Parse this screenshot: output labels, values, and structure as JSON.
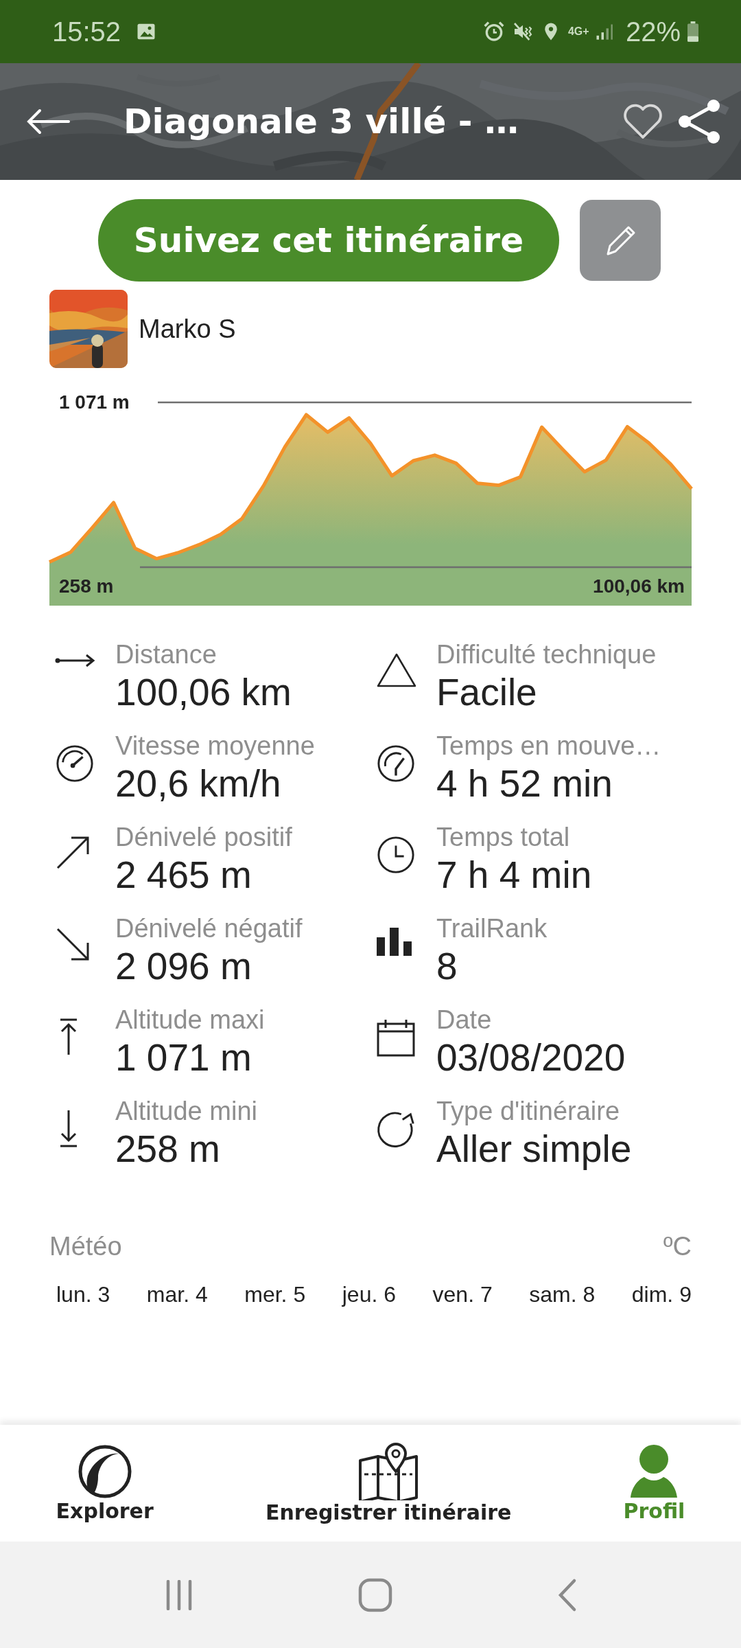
{
  "status_bar": {
    "time": "15:52",
    "network": "4G+",
    "battery": "22%"
  },
  "header": {
    "title": "Diagonale 3 villé - …",
    "favorite": false
  },
  "follow_button": "Suivez cet itinéraire",
  "author": {
    "name": "Marko S"
  },
  "elevation_profile": {
    "max_altitude": "1 071 m",
    "min_altitude": "258 m",
    "distance": "100,06 km"
  },
  "stats": [
    {
      "label": "Distance",
      "value": "100,06 km"
    },
    {
      "label": "Difficulté technique",
      "value": "Facile"
    },
    {
      "label": "Vitesse moyenne",
      "value": "20,6 km/h"
    },
    {
      "label": "Temps en mouve…",
      "value": "4 h 52 min"
    },
    {
      "label": "Dénivelé positif",
      "value": "2 465 m"
    },
    {
      "label": "Temps total",
      "value": "7 h 4 min"
    },
    {
      "label": "Dénivelé négatif",
      "value": "2 096 m"
    },
    {
      "label": "TrailRank",
      "value": "8"
    },
    {
      "label": "Altitude maxi",
      "value": "1 071 m"
    },
    {
      "label": "Date",
      "value": "03/08/2020"
    },
    {
      "label": "Altitude mini",
      "value": "258 m"
    },
    {
      "label": "Type d'itinéraire",
      "value": "Aller simple"
    }
  ],
  "weather": {
    "title": "Météo",
    "unit": "ºC",
    "days": [
      "lun. 3",
      "mar. 4",
      "mer. 5",
      "jeu. 6",
      "ven. 7",
      "sam. 8",
      "dim. 9"
    ]
  },
  "bottom_nav": [
    {
      "label": "Explorer",
      "selected": false
    },
    {
      "label": "Enregistrer itinéraire",
      "selected": false
    },
    {
      "label": "Profil",
      "selected": true
    }
  ]
}
